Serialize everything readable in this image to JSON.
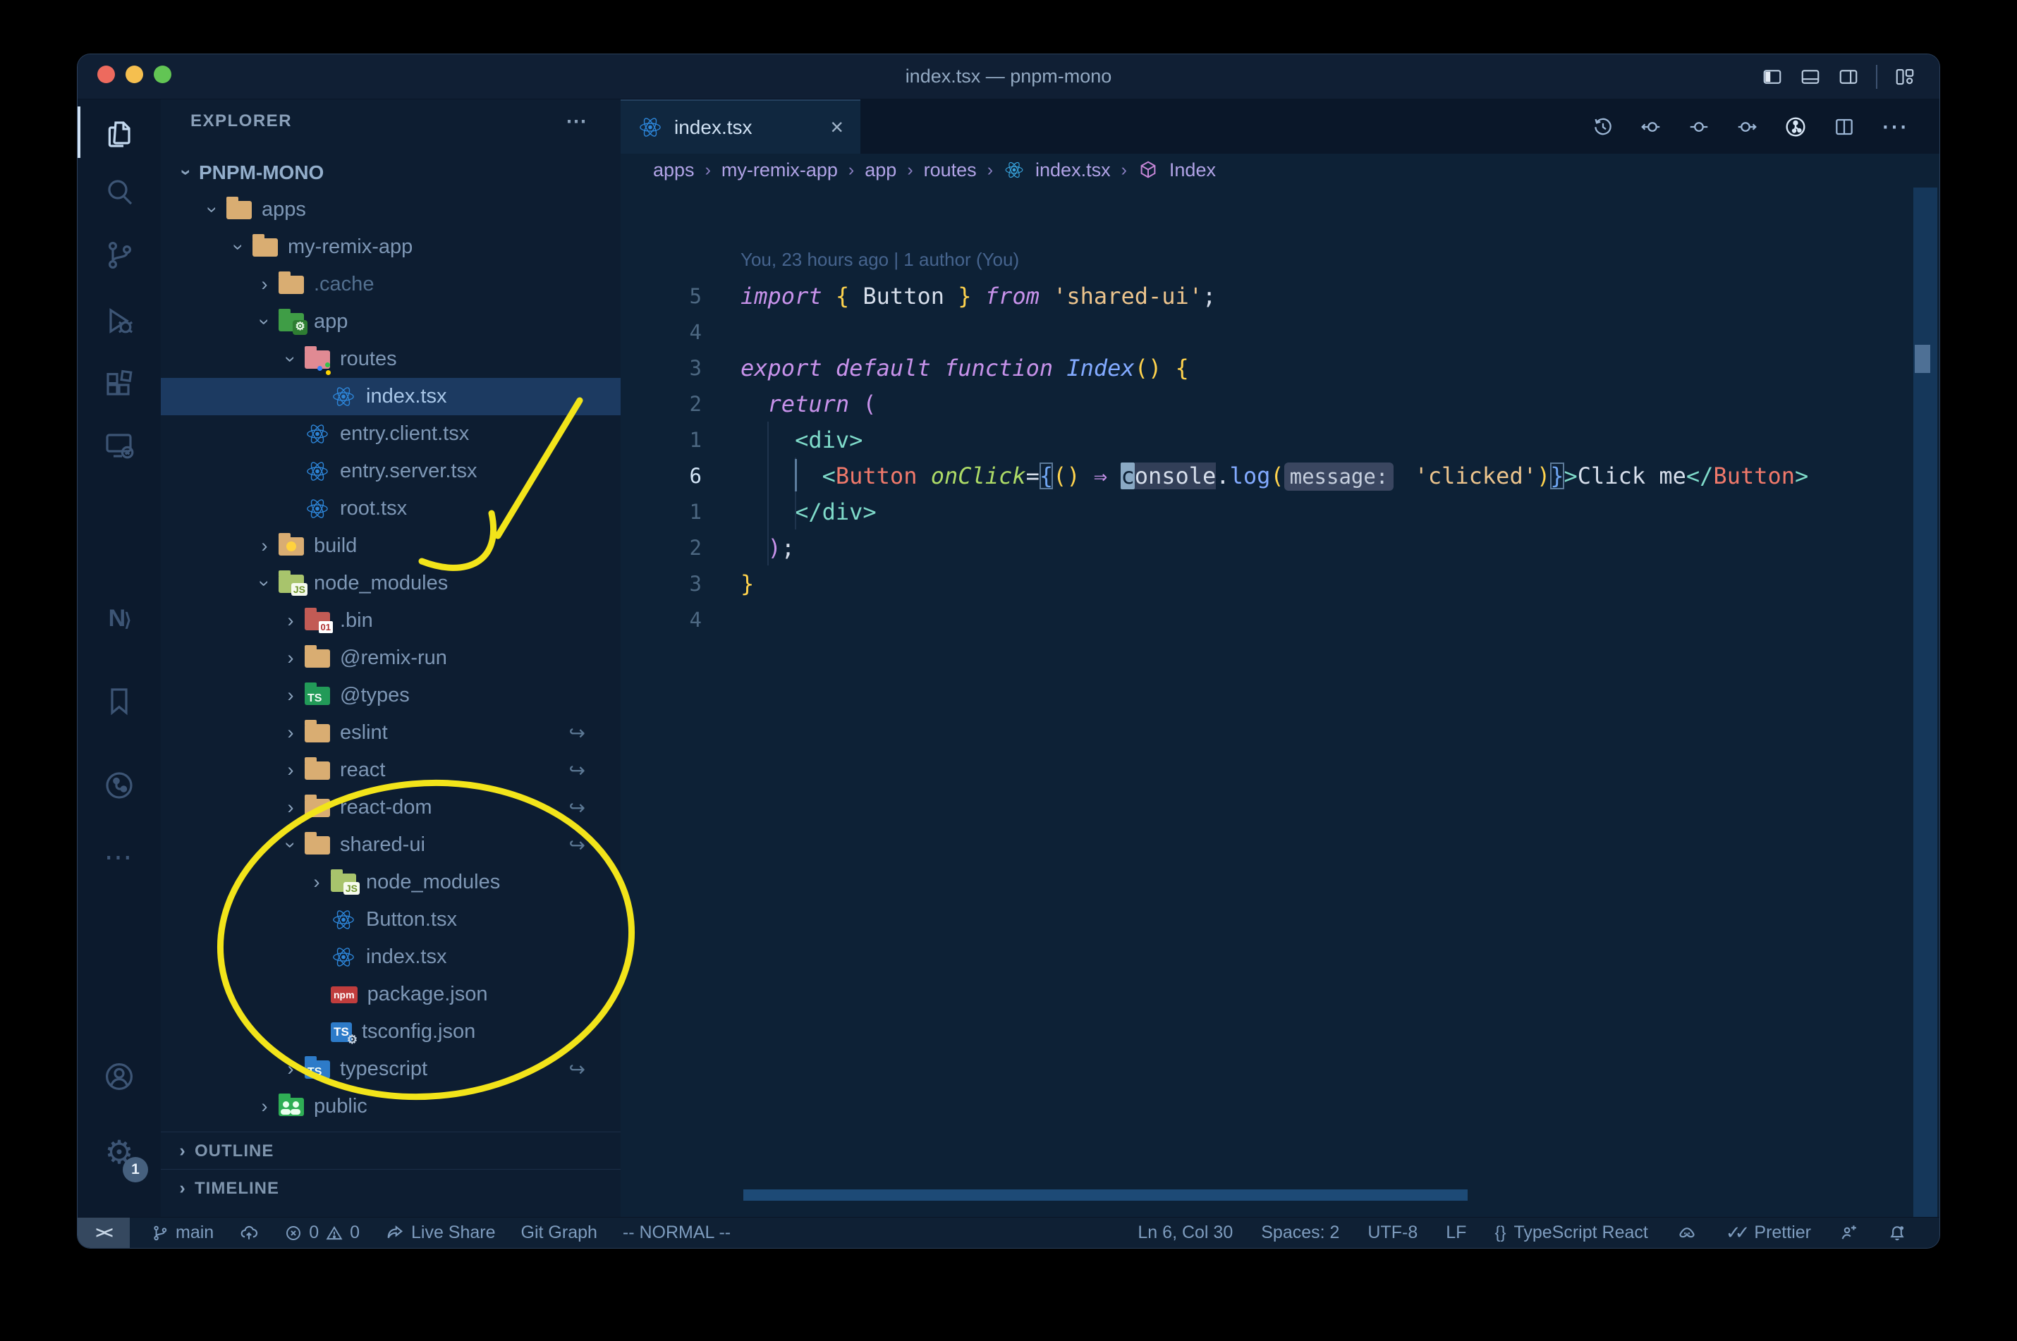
{
  "window": {
    "title": "index.tsx — pnpm-mono"
  },
  "activity_bar": {
    "settings_badge": "1"
  },
  "explorer": {
    "header": "EXPLORER",
    "workspace": "PNPM-MONO",
    "items": [
      {
        "label": "apps",
        "level": 1,
        "chev": "open",
        "icon": "folder-tan"
      },
      {
        "label": "my-remix-app",
        "level": 2,
        "chev": "open",
        "icon": "folder-tan"
      },
      {
        "label": ".cache",
        "level": 3,
        "chev": "closed",
        "icon": "folder-tan",
        "dim": true
      },
      {
        "label": "app",
        "level": 3,
        "chev": "open",
        "icon": "folder-app"
      },
      {
        "label": "routes",
        "level": 4,
        "chev": "open",
        "icon": "folder-routes"
      },
      {
        "label": "index.tsx",
        "level": 5,
        "icon": "react",
        "selected": true
      },
      {
        "label": "entry.client.tsx",
        "level": 4,
        "icon": "react"
      },
      {
        "label": "entry.server.tsx",
        "level": 4,
        "icon": "react"
      },
      {
        "label": "root.tsx",
        "level": 4,
        "icon": "react"
      },
      {
        "label": "build",
        "level": 3,
        "chev": "closed",
        "icon": "folder-build"
      },
      {
        "label": "node_modules",
        "level": 3,
        "chev": "open",
        "icon": "folder-node"
      },
      {
        "label": ".bin",
        "level": 4,
        "chev": "closed",
        "icon": "folder-bin"
      },
      {
        "label": "@remix-run",
        "level": 4,
        "chev": "closed",
        "icon": "folder-tan"
      },
      {
        "label": "@types",
        "level": 4,
        "chev": "closed",
        "icon": "folder-types"
      },
      {
        "label": "eslint",
        "level": 4,
        "chev": "closed",
        "icon": "folder-tan",
        "symlink": true
      },
      {
        "label": "react",
        "level": 4,
        "chev": "closed",
        "icon": "folder-tan",
        "symlink": true
      },
      {
        "label": "react-dom",
        "level": 4,
        "chev": "closed",
        "icon": "folder-tan",
        "symlink": true
      },
      {
        "label": "shared-ui",
        "level": 4,
        "chev": "open",
        "icon": "folder-tan",
        "symlink": true
      },
      {
        "label": "node_modules",
        "level": 5,
        "chev": "closed",
        "icon": "folder-node"
      },
      {
        "label": "Button.tsx",
        "level": 5,
        "icon": "react"
      },
      {
        "label": "index.tsx",
        "level": 5,
        "icon": "react"
      },
      {
        "label": "package.json",
        "level": 5,
        "icon": "npm"
      },
      {
        "label": "tsconfig.json",
        "level": 5,
        "icon": "tsconfig"
      },
      {
        "label": "typescript",
        "level": 4,
        "chev": "closed",
        "icon": "folder-ts",
        "symlink": true
      },
      {
        "label": "public",
        "level": 3,
        "chev": "closed",
        "icon": "folder-public"
      }
    ]
  },
  "sections": {
    "outline": "OUTLINE",
    "timeline": "TIMELINE"
  },
  "tab": {
    "label": "index.tsx",
    "close": "×"
  },
  "breadcrumbs": [
    "apps",
    "my-remix-app",
    "app",
    "routes",
    "index.tsx",
    "Index"
  ],
  "editor": {
    "lines": [
      {
        "blame": "You, 23 hours ago | 1 author (You)"
      },
      {
        "num": "5",
        "tokens": [
          [
            "kw",
            "import"
          ],
          [
            "w",
            " "
          ],
          [
            "y",
            "{"
          ],
          [
            "w",
            " Button "
          ],
          [
            "y",
            "}"
          ],
          [
            "w",
            " "
          ],
          [
            "kw",
            "from"
          ],
          [
            "w",
            " "
          ],
          [
            "s",
            "'shared-ui'"
          ],
          [
            "w",
            ";"
          ]
        ]
      },
      {
        "num": "4",
        "tokens": []
      },
      {
        "num": "3",
        "tokens": [
          [
            "kw",
            "export"
          ],
          [
            "w",
            " "
          ],
          [
            "kw",
            "default"
          ],
          [
            "w",
            " "
          ],
          [
            "kw",
            "function"
          ],
          [
            "w",
            " "
          ],
          [
            "fni",
            "Index"
          ],
          [
            "y",
            "()"
          ],
          [
            "w",
            " "
          ],
          [
            "y",
            "{"
          ]
        ]
      },
      {
        "num": "2",
        "tokens": [
          [
            "w",
            "  "
          ],
          [
            "kw",
            "return"
          ],
          [
            "w",
            " "
          ],
          [
            "mg",
            "("
          ]
        ]
      },
      {
        "num": "1",
        "tokens": [
          [
            "w",
            "    "
          ],
          [
            "tag",
            "<div>"
          ]
        ]
      },
      {
        "num": "6",
        "cur": true,
        "tokens": [
          [
            "w",
            "      "
          ],
          [
            "tag",
            "<"
          ],
          [
            "cmp",
            "Button"
          ],
          [
            "w",
            " "
          ],
          [
            "at",
            "onClick"
          ],
          [
            "w",
            "="
          ],
          [
            "bm",
            "{"
          ],
          [
            "y",
            "()"
          ],
          [
            "w",
            " "
          ],
          [
            "mg",
            "⇒"
          ],
          [
            "w",
            " "
          ],
          [
            "curblk",
            "c"
          ],
          [
            "occ",
            "onsole"
          ],
          [
            "w",
            "."
          ],
          [
            "fn",
            "log"
          ],
          [
            "y",
            "("
          ],
          [
            "inl",
            "message:"
          ],
          [
            "w",
            " "
          ],
          [
            "s",
            "'clicked'"
          ],
          [
            "y",
            ")"
          ],
          [
            "bm",
            "}"
          ],
          [
            "tag",
            ">"
          ],
          [
            "w",
            "Click me"
          ],
          [
            "tag",
            "</"
          ],
          [
            "cmp",
            "Button"
          ],
          [
            "tag",
            ">"
          ]
        ]
      },
      {
        "num": "1",
        "tokens": [
          [
            "w",
            "    "
          ],
          [
            "tag",
            "</div>"
          ]
        ]
      },
      {
        "num": "2",
        "tokens": [
          [
            "w",
            "  "
          ],
          [
            "mg",
            ")"
          ],
          [
            "w",
            ";"
          ]
        ]
      },
      {
        "num": "3",
        "tokens": [
          [
            "y",
            "}"
          ]
        ]
      },
      {
        "num": "4",
        "tokens": []
      }
    ]
  },
  "status_bar": {
    "remote": "><",
    "branch": "main",
    "errors": "0",
    "warnings": "0",
    "live_share": "Live Share",
    "git_graph": "Git Graph",
    "vim_mode": "-- NORMAL --",
    "cursor_position": "Ln 6, Col 30",
    "indentation": "Spaces: 2",
    "encoding": "UTF-8",
    "eol": "LF",
    "language_braces": "{}",
    "language": "TypeScript React",
    "formatter": "Prettier"
  }
}
